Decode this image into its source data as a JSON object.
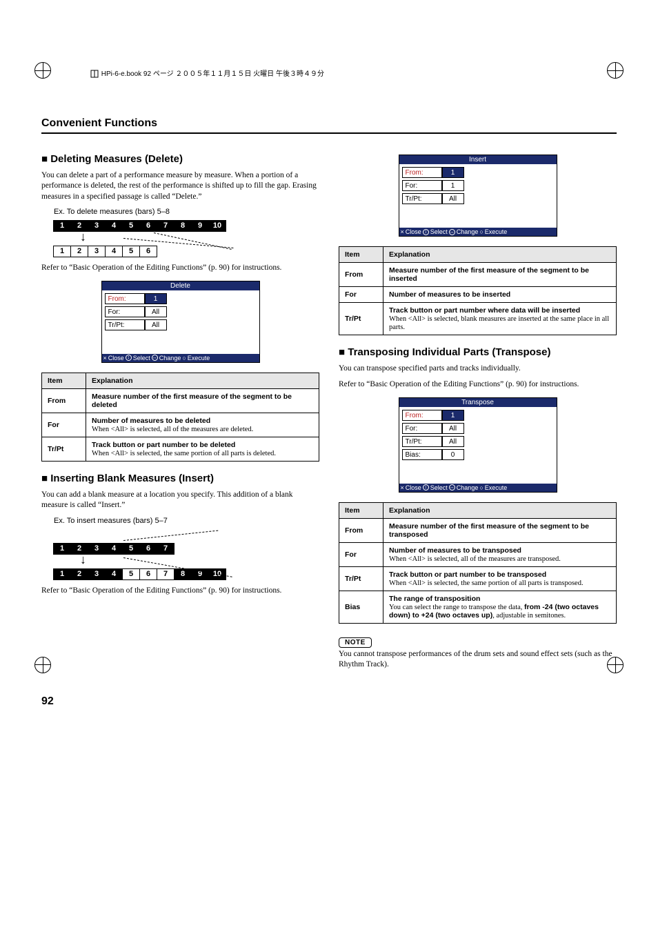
{
  "meta": {
    "header_text": "HPi-6-e.book 92 ページ ２００５年１１月１５日 火曜日 午後３時４９分"
  },
  "page_title": "Convenient Functions",
  "page_number": "92",
  "sections": {
    "delete": {
      "heading": "■ Deleting Measures (Delete)",
      "body": "You can delete a part of a performance measure by measure. When a portion of a performance is deleted, the rest of the performance is shifted up to fill the gap. Erasing measures in a specified passage is called “Delete.”",
      "caption": "Ex. To delete measures (bars) 5–8",
      "ref": "Refer to “Basic Operation of the Editing Functions” (p. 90) for instructions.",
      "dialog_title": "Delete",
      "dialog_rows": [
        {
          "label": "From:",
          "value": "1"
        },
        {
          "label": "For:",
          "value": "All"
        },
        {
          "label": "Tr/Pt:",
          "value": "All"
        }
      ],
      "footer": {
        "close": "Close",
        "select": "Select",
        "change": "Change",
        "execute": "Execute"
      },
      "table_header": {
        "item": "Item",
        "expl": "Explanation"
      },
      "table": [
        {
          "item": "From",
          "expl": "Measure number of the first measure of the segment to be deleted",
          "bold": true
        },
        {
          "item": "For",
          "expl_bold": "Number of measures to be deleted",
          "expl_plain": "When <All> is selected, all of the measures are deleted."
        },
        {
          "item": "Tr/Pt",
          "expl_bold": "Track button or part number to be deleted",
          "expl_plain": "When <All> is selected, the same portion of all parts is deleted."
        }
      ],
      "diagram_top": [
        "1",
        "2",
        "3",
        "4",
        "5",
        "6",
        "7",
        "8",
        "9",
        "10"
      ],
      "diagram_bottom": [
        "1",
        "2",
        "3",
        "4",
        "5",
        "6"
      ]
    },
    "insert": {
      "heading": "■ Inserting Blank Measures (Insert)",
      "body": "You can add a blank measure at a location you specify. This addition of a blank measure is called “Insert.”",
      "caption": "Ex. To insert measures (bars) 5–7",
      "ref": "Refer to “Basic Operation of the Editing Functions” (p. 90) for instructions.",
      "dialog_title": "Insert",
      "dialog_rows": [
        {
          "label": "From:",
          "value": "1"
        },
        {
          "label": "For:",
          "value": "1"
        },
        {
          "label": "Tr/Pt:",
          "value": "All"
        }
      ],
      "footer": {
        "close": "Close",
        "select": "Select",
        "change": "Change",
        "execute": "Execute"
      },
      "table_header": {
        "item": "Item",
        "expl": "Explanation"
      },
      "table": [
        {
          "item": "From",
          "expl": "Measure number of the first measure of the segment to be inserted",
          "bold": true
        },
        {
          "item": "For",
          "expl": "Number of measures to be inserted",
          "bold": true
        },
        {
          "item": "Tr/Pt",
          "expl_bold": "Track button or part number where data will be inserted",
          "expl_plain": "When <All> is selected, blank measures are inserted at the same place in all parts."
        }
      ],
      "diagram_top": [
        "1",
        "2",
        "3",
        "4",
        "5",
        "6",
        "7"
      ],
      "diagram_bottom": [
        "1",
        "2",
        "3",
        "4",
        "5",
        "6",
        "7",
        "8",
        "9",
        "10"
      ]
    },
    "transpose": {
      "heading": "■ Transposing Individual Parts (Transpose)",
      "body1": "You can transpose specified parts and tracks individually.",
      "ref": "Refer to “Basic Operation of the Editing Functions” (p. 90) for instructions.",
      "dialog_title": "Transpose",
      "dialog_rows": [
        {
          "label": "From:",
          "value": "1"
        },
        {
          "label": "For:",
          "value": "All"
        },
        {
          "label": "Tr/Pt:",
          "value": "All"
        },
        {
          "label": "Bias:",
          "value": "0"
        }
      ],
      "footer": {
        "close": "Close",
        "select": "Select",
        "change": "Change",
        "execute": "Execute"
      },
      "table_header": {
        "item": "Item",
        "expl": "Explanation"
      },
      "table": [
        {
          "item": "From",
          "expl": "Measure number of the first measure of the segment to be transposed",
          "bold": true
        },
        {
          "item": "For",
          "expl_bold": "Number of measures to be transposed",
          "expl_plain": "When <All> is selected, all of the measures are transposed."
        },
        {
          "item": "Tr/Pt",
          "expl_bold": "Track button or part number to be transposed",
          "expl_plain": "When <All> is selected, the same portion of all parts is transposed."
        },
        {
          "item": "Bias",
          "expl_bold": "The range of transposition",
          "expl_plain_pre": "You can select the range to transpose the data, ",
          "expl_bold2": "from -24 (two octaves down) to +24 (two octaves up)",
          "expl_plain_post": ", adjustable in semitones."
        }
      ],
      "note_label": "NOTE",
      "note_text": "You cannot transpose performances of the drum sets and sound effect sets (such as the Rhythm Track)."
    }
  }
}
